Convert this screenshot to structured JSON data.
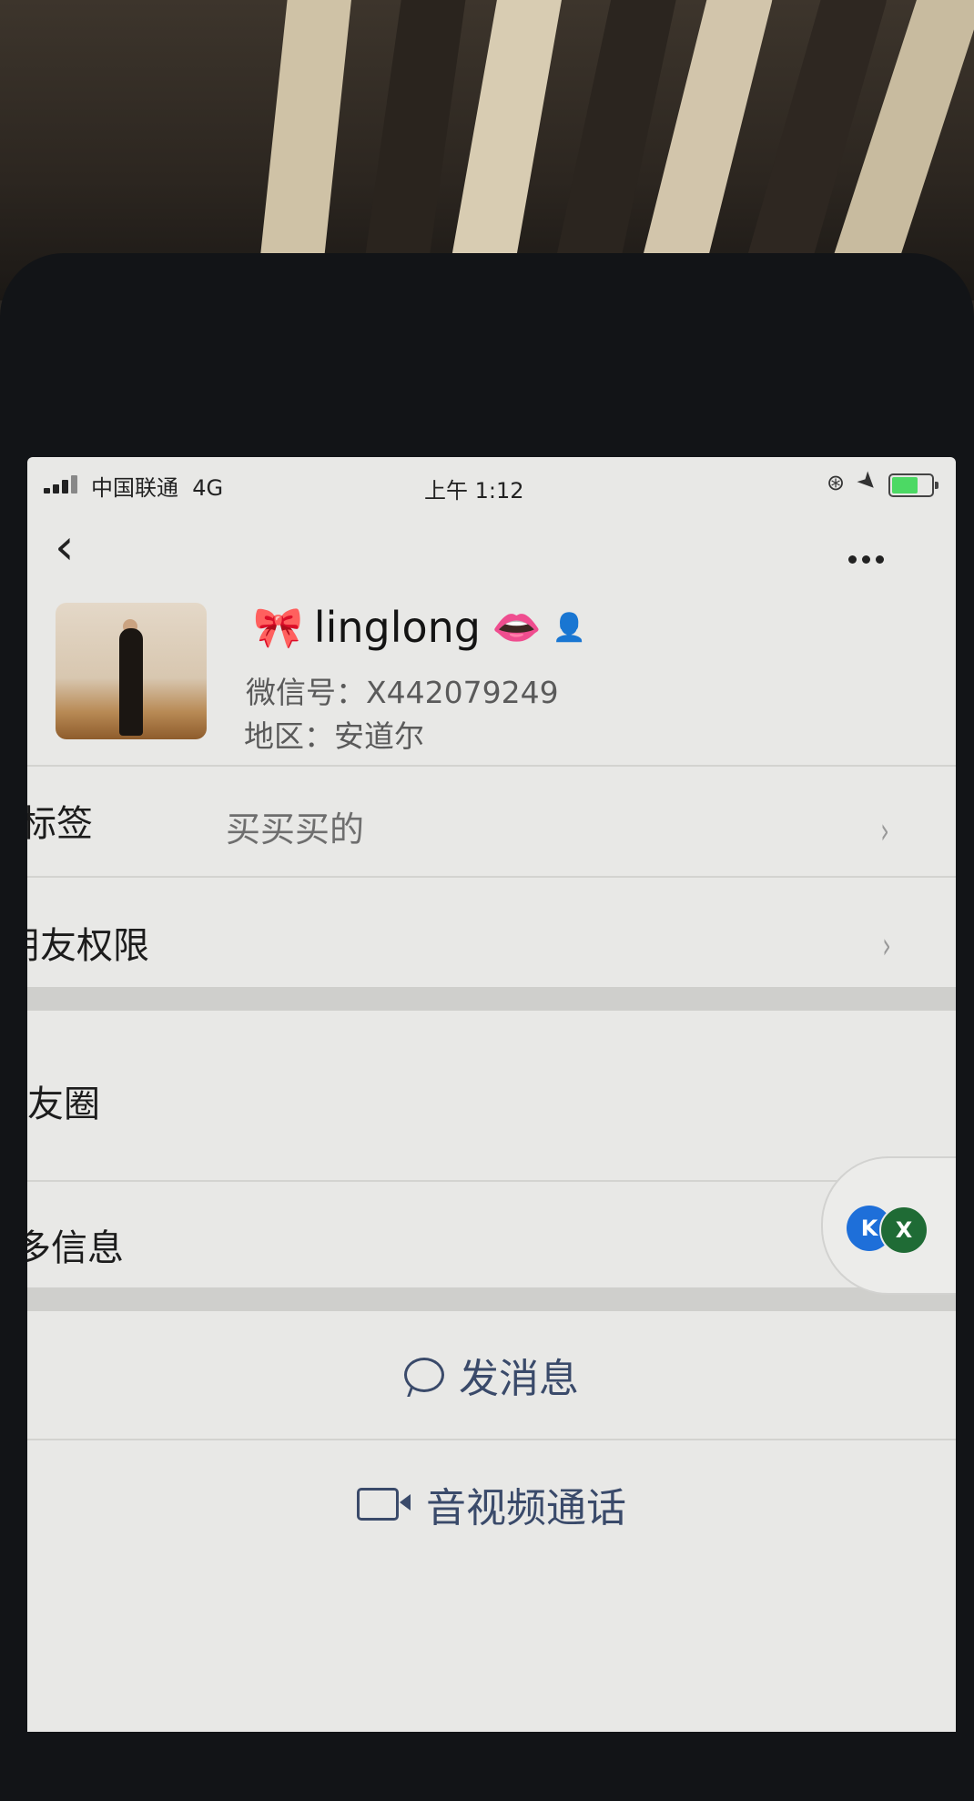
{
  "status_bar": {
    "carrier": "中国联通",
    "network": "4G",
    "time": "上午 1:12"
  },
  "profile": {
    "name": "linglong",
    "name_prefix_emoji": "🎀",
    "name_suffix_emoji": "👄",
    "badge": "👤",
    "wechat_id_label": "微信号：",
    "wechat_id": "X442079249",
    "region_label": "地区：",
    "region": "安道尔"
  },
  "rows": {
    "tags_label": "标签",
    "tags_value": "买买买的",
    "friend_permissions_label": "朋友权限",
    "moments_label": "朋友圈",
    "more_info_label": "更多信息"
  },
  "floating": {
    "icon1_text": "K",
    "icon2_text": "X"
  },
  "actions": {
    "send_message": "发消息",
    "video_call": "音视频通话"
  },
  "colors": {
    "screen_bg": "#e8e8e6",
    "action_text": "#3a4a6a",
    "battery": "#4cd964"
  }
}
